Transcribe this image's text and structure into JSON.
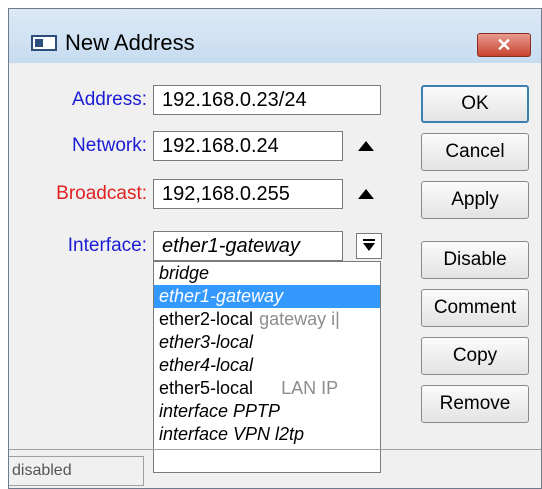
{
  "window": {
    "title": "New Address",
    "close_label": "✕"
  },
  "form": {
    "address_label": "Address:",
    "address_value": "192.168.0.23/24",
    "network_label": "Network:",
    "network_value": "192.168.0.24",
    "broadcast_label": "Broadcast:",
    "broadcast_value": "192,168.0.255",
    "interface_label": "Interface:",
    "interface_value": "ether1-gateway"
  },
  "buttons": {
    "ok": "OK",
    "cancel": "Cancel",
    "apply": "Apply",
    "disable": "Disable",
    "comment": "Comment",
    "copy": "Copy",
    "remove": "Remove"
  },
  "dropdown": {
    "items": [
      {
        "label": "bridge",
        "comment": ""
      },
      {
        "label": "ether1-gateway",
        "comment": ""
      },
      {
        "label": "ether2-local",
        "comment": "gateway i|"
      },
      {
        "label": "ether3-local",
        "comment": ""
      },
      {
        "label": "ether4-local",
        "comment": ""
      },
      {
        "label": "ether5-local",
        "comment": "LAN IP"
      },
      {
        "label": "interface PPTP",
        "comment": ""
      },
      {
        "label": "interface VPN l2tp",
        "comment": ""
      }
    ]
  },
  "status": {
    "text": "disabled"
  },
  "colors": {
    "label_blue": "#1b1bd6",
    "label_red": "#e01f1f",
    "selection": "#3399ff"
  }
}
